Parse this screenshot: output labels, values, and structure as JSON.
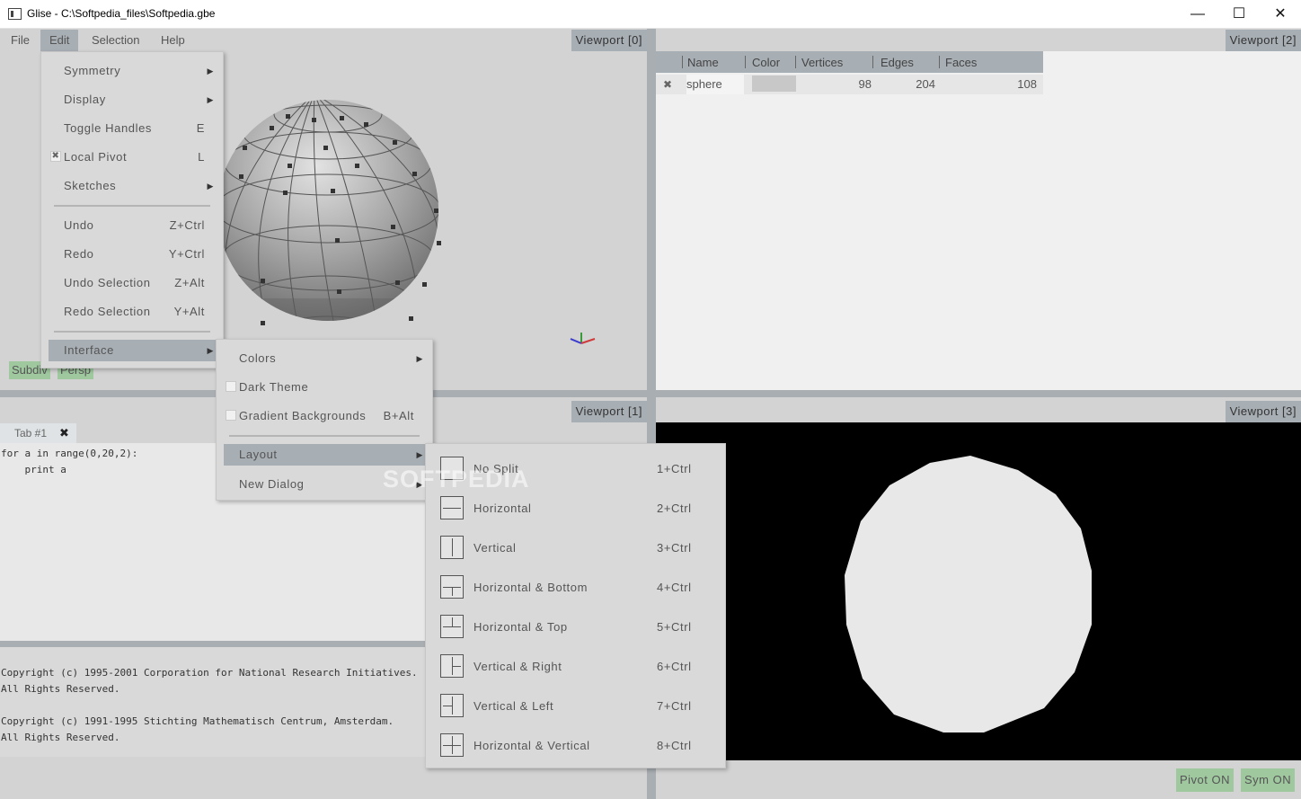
{
  "window": {
    "title": "Glise - C:\\Softpedia_files\\Softpedia.gbe",
    "controls": {
      "minimize": "—",
      "maximize": "☐",
      "close": "✕"
    }
  },
  "menubar": {
    "items": [
      {
        "label": "File"
      },
      {
        "label": "Edit"
      },
      {
        "label": "Selection"
      },
      {
        "label": "Help"
      }
    ]
  },
  "viewports": {
    "v0": "Viewport  [0]",
    "v1": "Viewport  [1]",
    "v2": "Viewport  [2]",
    "v3": "Viewport  [3]"
  },
  "edit_menu": {
    "symmetry": "Symmetry",
    "display": "Display",
    "toggle_handles": "Toggle  Handles",
    "toggle_handles_sc": "E",
    "local_pivot": "Local  Pivot",
    "local_pivot_sc": "L",
    "local_pivot_checked": true,
    "sketches": "Sketches",
    "undo": "Undo",
    "undo_sc": "Z+Ctrl",
    "redo": "Redo",
    "redo_sc": "Y+Ctrl",
    "undo_sel": "Undo  Selection",
    "undo_sel_sc": "Z+Alt",
    "redo_sel": "Redo  Selection",
    "redo_sel_sc": "Y+Alt",
    "interface": "Interface"
  },
  "interface_menu": {
    "colors": "Colors",
    "dark_theme": "Dark  Theme",
    "gradient": "Gradient  Backgrounds",
    "gradient_sc": "B+Alt",
    "layout": "Layout",
    "new_dialog": "New  Dialog"
  },
  "layout_menu": [
    {
      "label": "No  Split",
      "shortcut": "1+Ctrl"
    },
    {
      "label": "Horizontal",
      "shortcut": "2+Ctrl"
    },
    {
      "label": "Vertical",
      "shortcut": "3+Ctrl"
    },
    {
      "label": "Horizontal  &  Bottom",
      "shortcut": "4+Ctrl"
    },
    {
      "label": "Horizontal  &  Top",
      "shortcut": "5+Ctrl"
    },
    {
      "label": "Vertical  &  Right",
      "shortcut": "6+Ctrl"
    },
    {
      "label": "Vertical  &  Left",
      "shortcut": "7+Ctrl"
    },
    {
      "label": "Horizontal  &  Vertical",
      "shortcut": "8+Ctrl"
    }
  ],
  "viewport0_chips": {
    "subdiv": "Subdiv",
    "persp": "Persp"
  },
  "objects_table": {
    "headers": [
      "Name",
      "Color",
      "Vertices",
      "Edges",
      "Faces"
    ],
    "rows": [
      {
        "name": "sphere",
        "color": "#c8c8c8",
        "vertices": "98",
        "edges": "204",
        "faces": "108"
      }
    ]
  },
  "script_editor": {
    "tab_label": "Tab #1",
    "tab_close": "✖",
    "code_line1": "for a in range(0,20,2):",
    "code_line2": "    print a"
  },
  "console": {
    "line1": "Copyright (c) 1995-2001 Corporation for National Research Initiatives.",
    "line2": "All Rights Reserved.",
    "line3": "Copyright (c) 1991-1995 Stichting Mathematisch Centrum, Amsterdam.",
    "line4": "All Rights Reserved."
  },
  "status": {
    "pivot": "Pivot  ON",
    "sym": "Sym  ON"
  },
  "watermark": "SOFTPEDIA",
  "colors": {
    "accent": "#a7aeb4",
    "toggle_on": "#9fc89f",
    "viewport3_bg": "#000000",
    "mesh": "#9a9a9a"
  }
}
